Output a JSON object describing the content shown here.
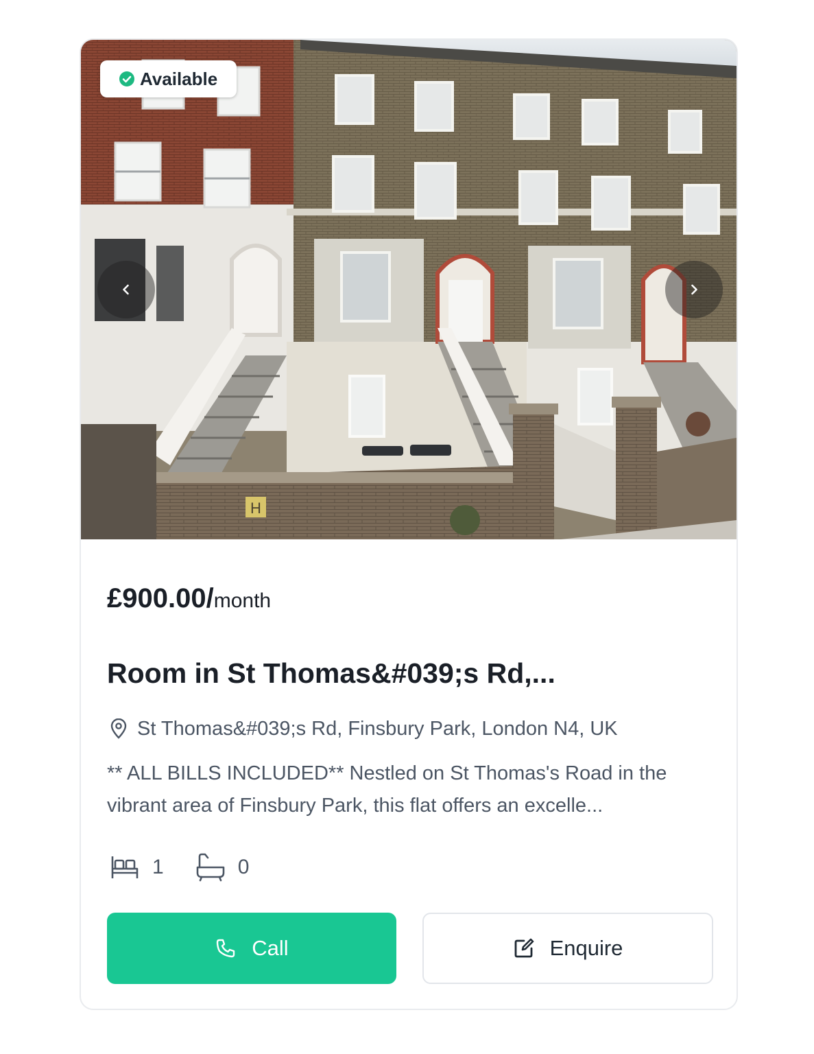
{
  "listing": {
    "status": "Available",
    "price": "£900.00/",
    "price_period": "month",
    "title": "Room in St Thomas&#039;s Rd,...",
    "address": "St Thomas&#039;s Rd, Finsbury Park, London N4, UK",
    "description": "** ALL BILLS INCLUDED** Nestled on St Thomas's Road in the vibrant area of Finsbury Park, this flat offers an excelle...",
    "bedrooms": "1",
    "bathrooms": "0"
  },
  "gallery": {
    "prev_icon": "chevron-left-icon",
    "next_icon": "chevron-right-icon"
  },
  "actions": {
    "call_label": "Call",
    "enquire_label": "Enquire"
  },
  "colors": {
    "accent": "#19c793",
    "status_green": "#1db981",
    "text_dark": "#1a1f27",
    "text_muted": "#4b5563"
  }
}
